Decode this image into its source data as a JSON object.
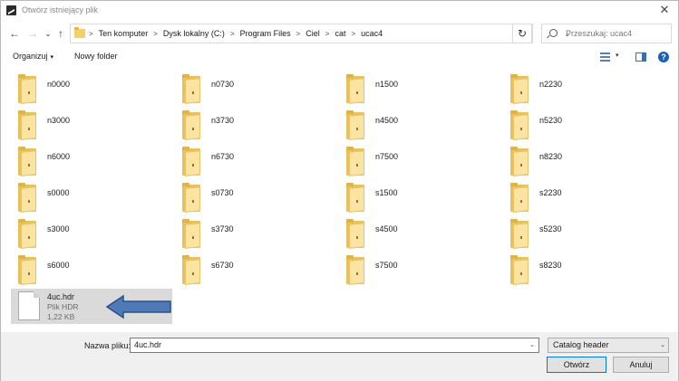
{
  "window": {
    "title": "Otwórz istniejący plik",
    "close_glyph": "✕"
  },
  "nav": {
    "back_glyph": "←",
    "forward_glyph": "→",
    "history_glyph": "⌄",
    "up_glyph": "↑",
    "breadcrumbs": [
      "Ten komputer",
      "Dysk lokalny (C:)",
      "Program Files",
      "Ciel",
      "cat",
      "ucac4"
    ],
    "breadcrumb_separator": ">",
    "dropdown_glyph": "⌄",
    "refresh_glyph": "↻",
    "search_placeholder": "Przeszukaj: ucac4"
  },
  "toolbar": {
    "organize_label": "Organizuj",
    "organize_caret": "▾",
    "new_folder_label": "Nowy folder",
    "view_caret": "▾",
    "help_glyph": "?"
  },
  "folders": [
    [
      "n0000",
      "n0730",
      "n1500",
      "n2230"
    ],
    [
      "n3000",
      "n3730",
      "n4500",
      "n5230"
    ],
    [
      "n6000",
      "n6730",
      "n7500",
      "n8230"
    ],
    [
      "s0000",
      "s0730",
      "s1500",
      "s2230"
    ],
    [
      "s3000",
      "s3730",
      "s4500",
      "s5230"
    ],
    [
      "s6000",
      "s6730",
      "s7500",
      "s8230"
    ]
  ],
  "file": {
    "name": "4uc.hdr",
    "type": "Plik HDR",
    "size": "1,22 KB"
  },
  "colors": {
    "arrow_fill": "#4f7ab8",
    "arrow_stroke": "#2f4f7f",
    "accent": "#0078d7"
  },
  "bottom": {
    "filename_label": "Nazwa pliku:",
    "filename_value": "4uc.hdr",
    "filename_drop_glyph": "⌄",
    "filter_value": "Catalog header",
    "filter_drop_glyph": "⌄",
    "open_label": "Otwórz",
    "cancel_label": "Anuluj"
  }
}
